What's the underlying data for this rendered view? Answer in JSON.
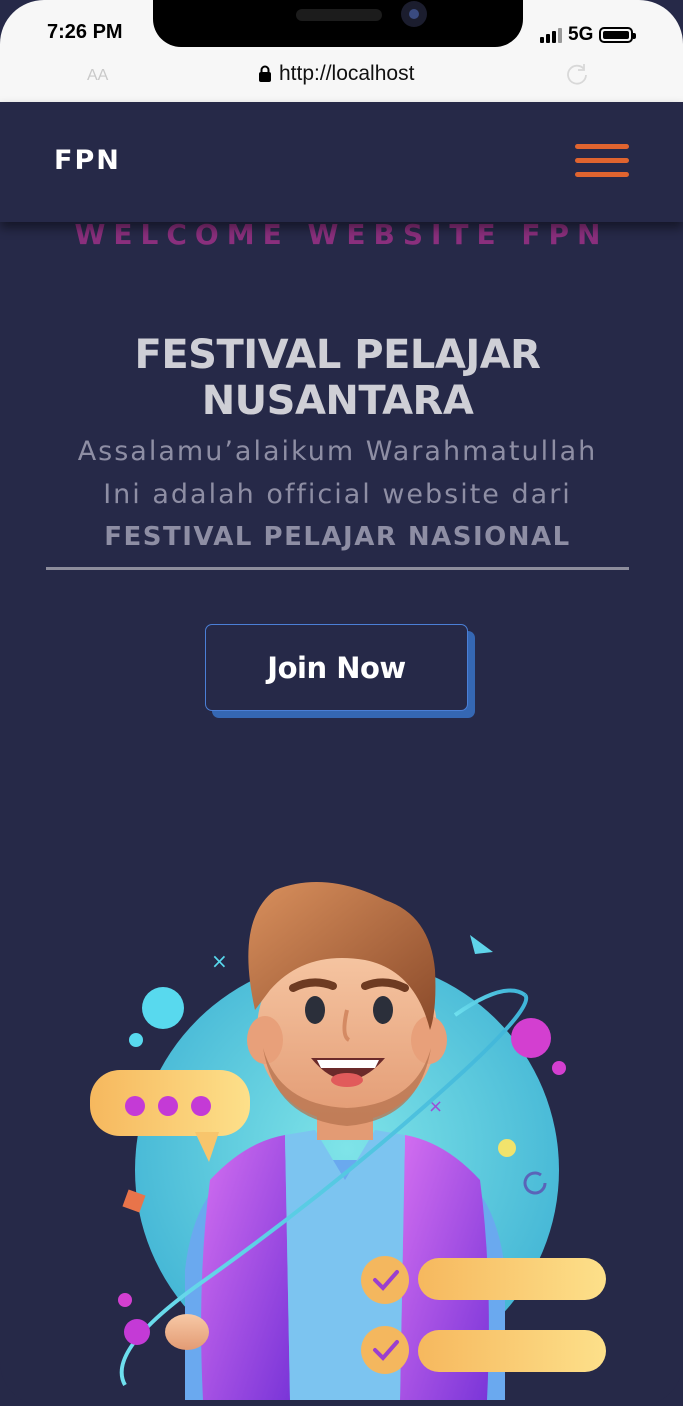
{
  "status_bar": {
    "time": "7:26 PM",
    "network": "5G"
  },
  "browser": {
    "text_size_label": "AA",
    "url": "http://localhost"
  },
  "navbar": {
    "brand": "FPN"
  },
  "hero": {
    "welcome": "WELCOME WEBSITE FPN",
    "title": "FESTIVAL PELAJAR NUSANTARA",
    "line1": "Assalamu’alaikum Warahmatullah",
    "line2": "Ini adalah official website dari",
    "line3": "FESTIVAL PELAJAR NASIONAL",
    "cta_label": "Join Now"
  },
  "colors": {
    "background": "#262948",
    "accent_menu": "#e0642f",
    "welcome_text": "#8a2f7d",
    "button_border": "#4b7fd6"
  },
  "icons": [
    "lock-icon",
    "reload-icon",
    "hamburger-menu-icon",
    "signal-icon",
    "battery-icon"
  ]
}
